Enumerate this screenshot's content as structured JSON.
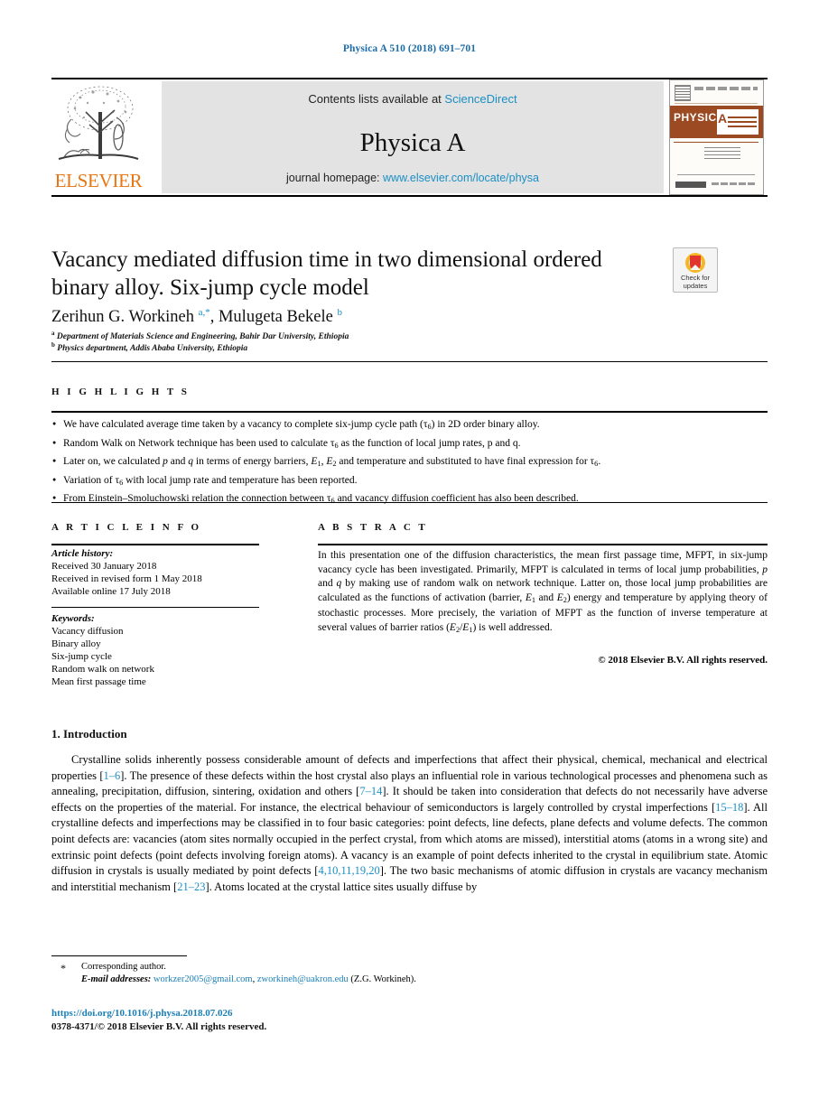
{
  "running_head": "Physica A 510 (2018) 691–701",
  "masthead": {
    "contents_prefix": "Contents lists available at ",
    "sciencedirect": "ScienceDirect",
    "journal_name": "Physica A",
    "homepage_prefix": "journal homepage: ",
    "homepage_url": "www.elsevier.com/locate/physa",
    "publisher_wordmark": "ELSEVIER",
    "cover": {
      "banner_title": "PHYSICA",
      "banner_letter": "A"
    },
    "link_color": "#1b8fc4",
    "elsevier_orange": "#e87511"
  },
  "article": {
    "title": "Vacancy mediated diffusion time in two dimensional ordered binary alloy. Six-jump cycle model",
    "authors_html": "Zerihun G. Workineh <sup>a,*</sup>, Mulugeta Bekele <sup>b</sup>",
    "affiliation_a": "Department of Materials Science and Engineering, Bahir Dar University, Ethiopia",
    "affiliation_b": "Physics department, Addis Ababa University, Ethiopia",
    "affiliation_a_marker": "a",
    "affiliation_b_marker": "b"
  },
  "crossmark": {
    "line1": "Check for",
    "line2": "updates"
  },
  "highlights": {
    "label": "H I G H L I G H T S",
    "items": [
      "We have calculated average time taken by a vacancy to complete six-jump cycle path (τ<sub>6</sub>) in 2D order binary alloy.",
      "Random Walk on Network technique has been used to calculate τ<sub>6</sub> as the function of local jump rates, p and q.",
      "Later on, we calculated <span class=\"ital\">p</span> and <span class=\"ital\">q</span> in terms of energy barriers, <span class=\"ital\">E</span><sub>1</sub>, <span class=\"ital\">E</span><sub>2</sub> and temperature and substituted to have final expression for τ<sub>6</sub>.",
      "Variation of τ<sub>6</sub> with local jump rate and temperature has been reported.",
      "From Einstein–Smoluchowski relation the connection between τ<sub>6</sub> and vacancy diffusion coefficient has also been described."
    ]
  },
  "article_info": {
    "label": "A R T I C L E    I N F O",
    "history_heading": "Article history:",
    "history": [
      "Received 30 January 2018",
      "Received in revised form 1 May 2018",
      "Available online 17 July 2018"
    ],
    "keywords_heading": "Keywords:",
    "keywords": [
      "Vacancy diffusion",
      "Binary alloy",
      "Six-jump cycle",
      "Random walk on network",
      "Mean first passage time"
    ]
  },
  "abstract": {
    "label": "A B S T R A C T",
    "body_html": "In this presentation one of the diffusion characteristics, the mean first passage time, MFPT, in six-jump vacancy cycle has been investigated. Primarily, MFPT is calculated in terms of local jump probabilities, <span class=\"ital\">p</span> and <span class=\"ital\">q</span> by making use of random walk on network technique. Latter on, those local jump probabilities are calculated as the functions of activation (barrier, <span class=\"ital\">E</span><sub>1</sub> and <span class=\"ital\">E</span><sub>2</sub>) energy and temperature by applying theory of stochastic processes. More precisely, the variation of MFPT as the function of inverse temperature at several values of barrier ratios (<span class=\"ital\">E</span><sub>2</sub>/<span class=\"ital\">E</span><sub>1</sub>) is well addressed.",
    "copyright": "© 2018 Elsevier B.V. All rights reserved."
  },
  "introduction": {
    "heading": "1. Introduction",
    "body_html": "Crystalline solids inherently possess considerable amount of defects and imperfections that affect their physical, chemical, mechanical and electrical properties [<span class=\"ref\">1–6</span>]. The presence of these defects within the host crystal also plays an influential role in various technological processes and phenomena such as annealing, precipitation, diffusion, sintering, oxidation and others [<span class=\"ref\">7–14</span>]. It should be taken into consideration that defects do not necessarily have adverse effects on the properties of the material. For instance, the electrical behaviour of semiconductors is largely controlled by crystal imperfections [<span class=\"ref\">15–18</span>]. All crystalline defects and imperfections may be classified in to four basic categories: point defects, line defects, plane defects and volume defects. The common point defects are: vacancies (atom sites normally occupied in the perfect crystal, from which atoms are missed), interstitial atoms (atoms in a wrong site) and extrinsic point defects (point defects involving foreign atoms). A vacancy is an example of point defects inherited to the crystal in equilibrium state. Atomic diffusion in crystals is usually mediated by point defects [<span class=\"ref\">4,10,11,19,20</span>]. The two basic mechanisms of atomic diffusion in crystals are vacancy mechanism and interstitial mechanism [<span class=\"ref\">21–23</span>]. Atoms located at the crystal lattice sites usually diffuse by"
  },
  "footer": {
    "corresponding_author": "Corresponding author.",
    "email_label": "E-mail addresses:",
    "email_1": "workzer2005@gmail.com",
    "email_2": "zworkineh@uakron.edu",
    "email_attribution": "(Z.G. Workineh).",
    "doi": "https://doi.org/10.1016/j.physa.2018.07.026",
    "issn_line": "0378-4371/© 2018 Elsevier B.V. All rights reserved."
  }
}
